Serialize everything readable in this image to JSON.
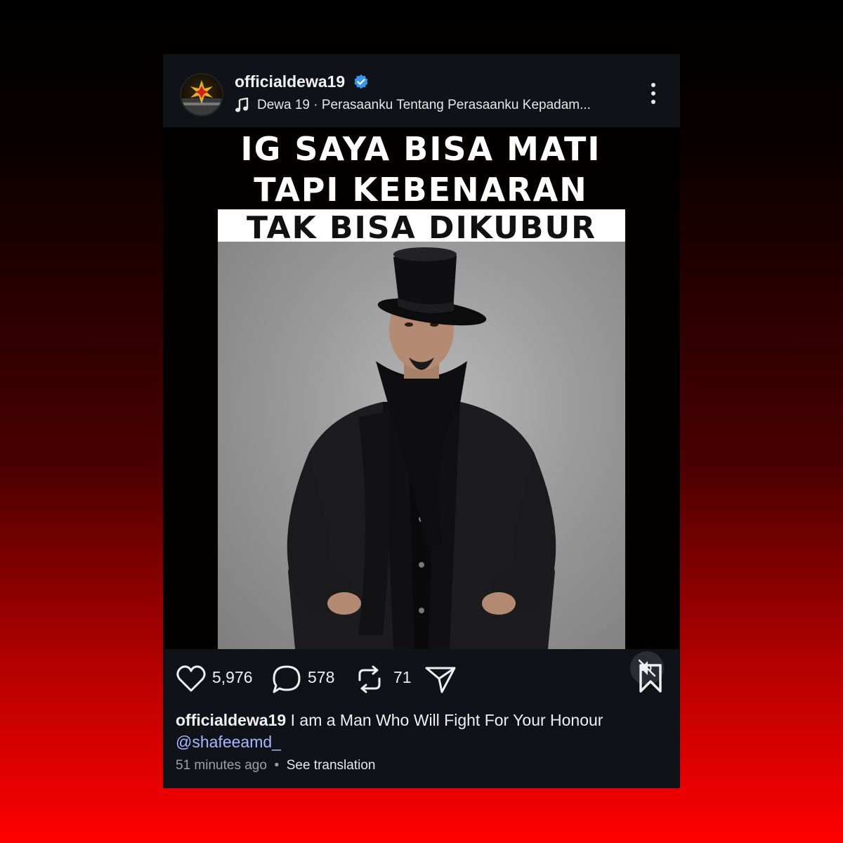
{
  "post": {
    "username": "officialdewa19",
    "verified": true,
    "music": "Dewa 19 · Perasaanku Tentang Perasaanku Kepadam...",
    "more_icon": "more-vertical-icon",
    "media": {
      "overlay_line1": "IG SAYA BISA MATI",
      "overlay_line2": "TAPI KEBENARAN",
      "overlay_line3": "TAK BISA DIKUBUR",
      "mute_icon": "speaker-muted-icon"
    },
    "actions": {
      "likes": "5,976",
      "comments": "578",
      "reposts": "71",
      "share_icon": "send-icon",
      "save_icon": "bookmark-icon"
    },
    "caption": {
      "user": "officialdewa19",
      "text": "I am a Man Who Will Fight For Your Honour",
      "mention": "@shafeeamd_"
    },
    "meta": {
      "time": "51 minutes ago",
      "separator": "•",
      "see_translation": "See translation"
    }
  },
  "colors": {
    "card_bg": "#0f1217",
    "verified_blue": "#3897f0",
    "mention": "#a9b7ff",
    "bg_top": "#000000",
    "bg_bottom": "#ff0000"
  }
}
